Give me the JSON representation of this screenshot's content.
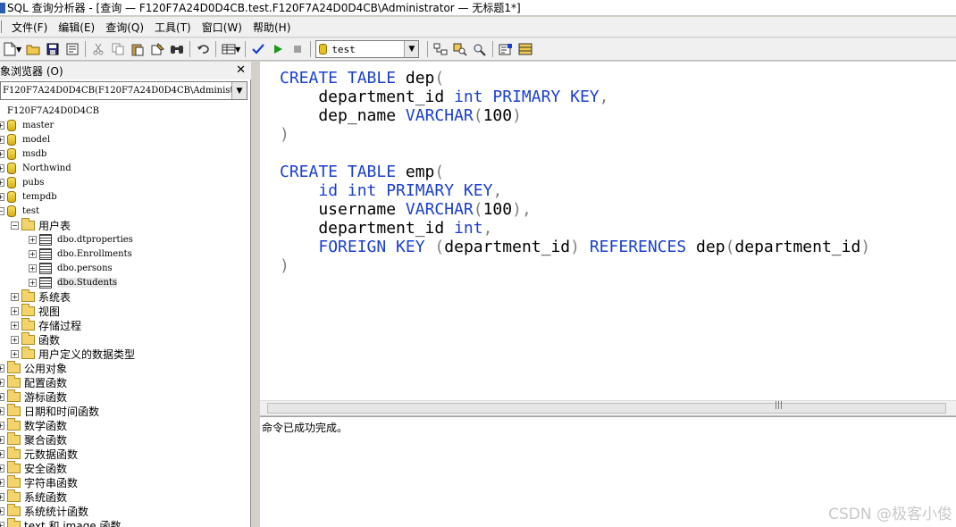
{
  "window": {
    "title": "SQL 查询分析器 - [查询 — F120F7A24D0D4CB.test.F120F7A24D0D4CB\\Administrator — 无标题1*]"
  },
  "menu": [
    "文件(F)",
    "编辑(E)",
    "查询(Q)",
    "工具(T)",
    "窗口(W)",
    "帮助(H)"
  ],
  "toolbar": {
    "database_selected": "test",
    "icons": [
      "new-query-icon",
      "open-icon",
      "save-icon",
      "insert-template-icon",
      "cut-icon",
      "copy-icon",
      "paste-icon",
      "clear-icon",
      "find-icon",
      "undo-icon",
      "results-mode-icon",
      "parse-icon",
      "execute-icon",
      "stop-icon",
      "object-browser-icon",
      "object-search-icon",
      "search-icon",
      "properties-icon",
      "grid-icon"
    ]
  },
  "object_browser": {
    "title": "象浏览器 (O)",
    "close": "✕",
    "server_combo": "F120F7A24D0D4CB(F120F7A24D0D4CB\\Administrator)",
    "tree": [
      {
        "label": "F120F7A24D0D4CB",
        "kind": "server",
        "level": 0
      },
      {
        "label": "master",
        "kind": "db",
        "level": 1
      },
      {
        "label": "model",
        "kind": "db",
        "level": 1
      },
      {
        "label": "msdb",
        "kind": "db",
        "level": 1
      },
      {
        "label": "Northwind",
        "kind": "db",
        "level": 1
      },
      {
        "label": "pubs",
        "kind": "db",
        "level": 1
      },
      {
        "label": "tempdb",
        "kind": "db",
        "level": 1
      },
      {
        "label": "test",
        "kind": "db",
        "level": 1
      },
      {
        "label": "用户表",
        "kind": "folder",
        "level": 2
      },
      {
        "label": "dbo.dtproperties",
        "kind": "table",
        "level": 3
      },
      {
        "label": "dbo.Enrollments",
        "kind": "table",
        "level": 3
      },
      {
        "label": "dbo.persons",
        "kind": "table",
        "level": 3
      },
      {
        "label": "dbo.Students",
        "kind": "table",
        "level": 3
      },
      {
        "label": "系统表",
        "kind": "folder",
        "level": 2
      },
      {
        "label": "视图",
        "kind": "folder",
        "level": 2
      },
      {
        "label": "存储过程",
        "kind": "folder",
        "level": 2
      },
      {
        "label": "函数",
        "kind": "folder",
        "level": 2
      },
      {
        "label": "用户定义的数据类型",
        "kind": "folder",
        "level": 2
      },
      {
        "label": "公用对象",
        "kind": "folder",
        "level": 0
      },
      {
        "label": "配置函数",
        "kind": "folder",
        "level": 1
      },
      {
        "label": "游标函数",
        "kind": "folder",
        "level": 1
      },
      {
        "label": "日期和时间函数",
        "kind": "folder",
        "level": 1
      },
      {
        "label": "数学函数",
        "kind": "folder",
        "level": 1
      },
      {
        "label": "聚合函数",
        "kind": "folder",
        "level": 1
      },
      {
        "label": "元数据函数",
        "kind": "folder",
        "level": 1
      },
      {
        "label": "安全函数",
        "kind": "folder",
        "level": 1
      },
      {
        "label": "字符串函数",
        "kind": "folder",
        "level": 1
      },
      {
        "label": "系统函数",
        "kind": "folder",
        "level": 1
      },
      {
        "label": "系统统计函数",
        "kind": "folder",
        "level": 1
      },
      {
        "label": "text 和 image 函数",
        "kind": "folder",
        "level": 1
      }
    ]
  },
  "editor": {
    "lines": [
      [
        [
          "kw",
          "CREATE TABLE"
        ],
        [
          "tx",
          " dep"
        ],
        [
          "pn",
          "("
        ]
      ],
      [
        [
          "tx",
          "    department_id "
        ],
        [
          "kw",
          "int PRIMARY KEY"
        ],
        [
          "pn",
          ","
        ]
      ],
      [
        [
          "tx",
          "    dep_name "
        ],
        [
          "kw",
          "VARCHAR"
        ],
        [
          "pn",
          "("
        ],
        [
          "tx",
          "100"
        ],
        [
          "pn",
          ")"
        ]
      ],
      [
        [
          "pn",
          ")"
        ]
      ],
      [
        [
          "tx",
          ""
        ]
      ],
      [
        [
          "kw",
          "CREATE TABLE"
        ],
        [
          "tx",
          " emp"
        ],
        [
          "pn",
          "("
        ]
      ],
      [
        [
          "tx",
          "    "
        ],
        [
          "kw",
          "id int PRIMARY KEY"
        ],
        [
          "pn",
          ","
        ]
      ],
      [
        [
          "tx",
          "    username "
        ],
        [
          "kw",
          "VARCHAR"
        ],
        [
          "pn",
          "("
        ],
        [
          "tx",
          "100"
        ],
        [
          "pn",
          "),"
        ]
      ],
      [
        [
          "tx",
          "    department_id "
        ],
        [
          "kw",
          "int"
        ],
        [
          "pn",
          ","
        ]
      ],
      [
        [
          "tx",
          "    "
        ],
        [
          "kw",
          "FOREIGN KEY"
        ],
        [
          "tx",
          " "
        ],
        [
          "pn",
          "("
        ],
        [
          "tx",
          "department_id"
        ],
        [
          "pn",
          ")"
        ],
        [
          "tx",
          " "
        ],
        [
          "kw",
          "REFERENCES"
        ],
        [
          "tx",
          " dep"
        ],
        [
          "pn",
          "("
        ],
        [
          "tx",
          "department_id"
        ],
        [
          "pn",
          ")"
        ]
      ],
      [
        [
          "pn",
          ")"
        ]
      ]
    ]
  },
  "results": {
    "message": "命令已成功完成。"
  },
  "watermark": "CSDN @极客小俊",
  "colors": {
    "keyword": "#1a3fd0",
    "punctuation": "#808080"
  }
}
